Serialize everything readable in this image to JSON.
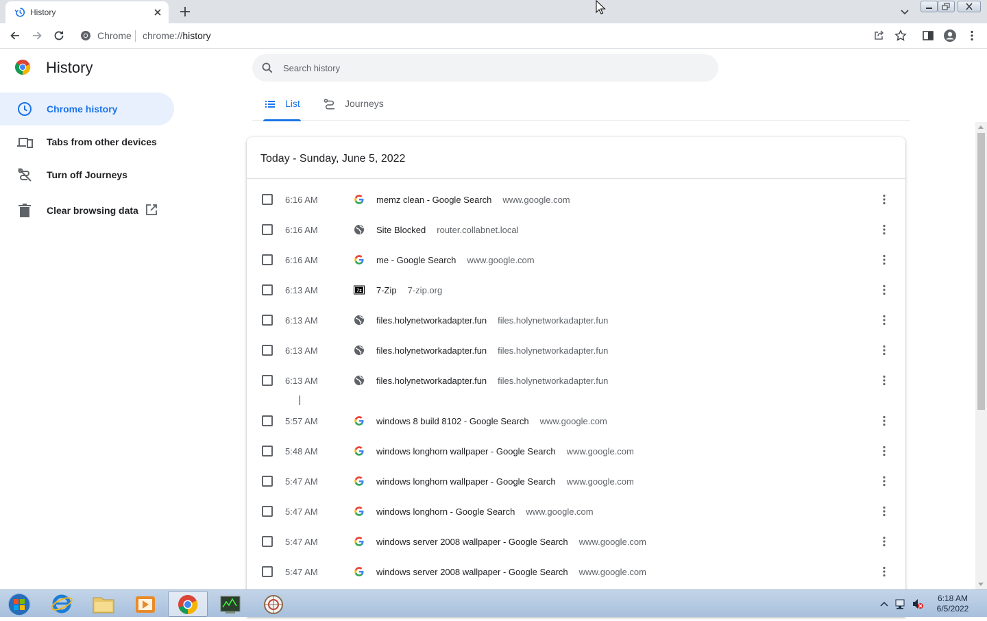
{
  "browser": {
    "tab_title": "History",
    "omnibox_chip": "Chrome",
    "url_scheme": "chrome://",
    "url_host": "history"
  },
  "sidebar": {
    "title": "History",
    "items": [
      {
        "label": "Chrome history",
        "icon": "clock-icon",
        "active": true
      },
      {
        "label": "Tabs from other devices",
        "icon": "devices-icon",
        "active": false
      },
      {
        "label": "Turn off Journeys",
        "icon": "journeys-off-icon",
        "active": false
      },
      {
        "label": "Clear browsing data",
        "icon": "trash-icon",
        "active": false
      }
    ]
  },
  "search": {
    "placeholder": "Search history",
    "value": ""
  },
  "tabs": [
    {
      "label": "List",
      "selected": true
    },
    {
      "label": "Journeys",
      "selected": false
    }
  ],
  "day_header": "Today - Sunday, June 5, 2022",
  "entries": [
    {
      "time": "6:16 AM",
      "title": "memz clean - Google Search",
      "domain": "www.google.com",
      "favicon": "google-icon"
    },
    {
      "time": "6:16 AM",
      "title": "Site Blocked",
      "domain": "router.collabnet.local",
      "favicon": "globe-icon"
    },
    {
      "time": "6:16 AM",
      "title": "me - Google Search",
      "domain": "www.google.com",
      "favicon": "google-icon"
    },
    {
      "time": "6:13 AM",
      "title": "7-Zip",
      "domain": "7-zip.org",
      "favicon": "7zip-icon"
    },
    {
      "time": "6:13 AM",
      "title": "files.holynetworkadapter.fun",
      "domain": "files.holynetworkadapter.fun",
      "favicon": "globe-icon"
    },
    {
      "time": "6:13 AM",
      "title": "files.holynetworkadapter.fun",
      "domain": "files.holynetworkadapter.fun",
      "favicon": "globe-icon"
    },
    {
      "time": "6:13 AM",
      "title": "files.holynetworkadapter.fun",
      "domain": "files.holynetworkadapter.fun",
      "favicon": "globe-icon"
    },
    {
      "time": "5:57 AM",
      "title": "windows 8 build 8102 - Google Search",
      "domain": "www.google.com",
      "favicon": "google-icon"
    },
    {
      "time": "5:48 AM",
      "title": "windows longhorn wallpaper - Google Search",
      "domain": "www.google.com",
      "favicon": "google-icon"
    },
    {
      "time": "5:47 AM",
      "title": "windows longhorn wallpaper - Google Search",
      "domain": "www.google.com",
      "favicon": "google-icon"
    },
    {
      "time": "5:47 AM",
      "title": "windows longhorn - Google Search",
      "domain": "www.google.com",
      "favicon": "google-icon"
    },
    {
      "time": "5:47 AM",
      "title": "windows server 2008 wallpaper - Google Search",
      "domain": "www.google.com",
      "favicon": "google-icon"
    },
    {
      "time": "5:47 AM",
      "title": "windows server 2008 wallpaper - Google Search",
      "domain": "www.google.com",
      "favicon": "google-icon"
    }
  ],
  "taskbar": {
    "apps": [
      "start-orb-icon",
      "internet-explorer-icon",
      "file-explorer-icon",
      "media-player-icon",
      "chrome-icon",
      "task-manager-icon",
      "app-icon"
    ],
    "active_app": "chrome-icon",
    "time": "6:18 AM",
    "date": "6/5/2022"
  },
  "colors": {
    "accent": "#1a73e8",
    "active_bg": "#e8f0fe",
    "tabstrip": "#dee1e6",
    "muted_text": "#5f6368"
  }
}
